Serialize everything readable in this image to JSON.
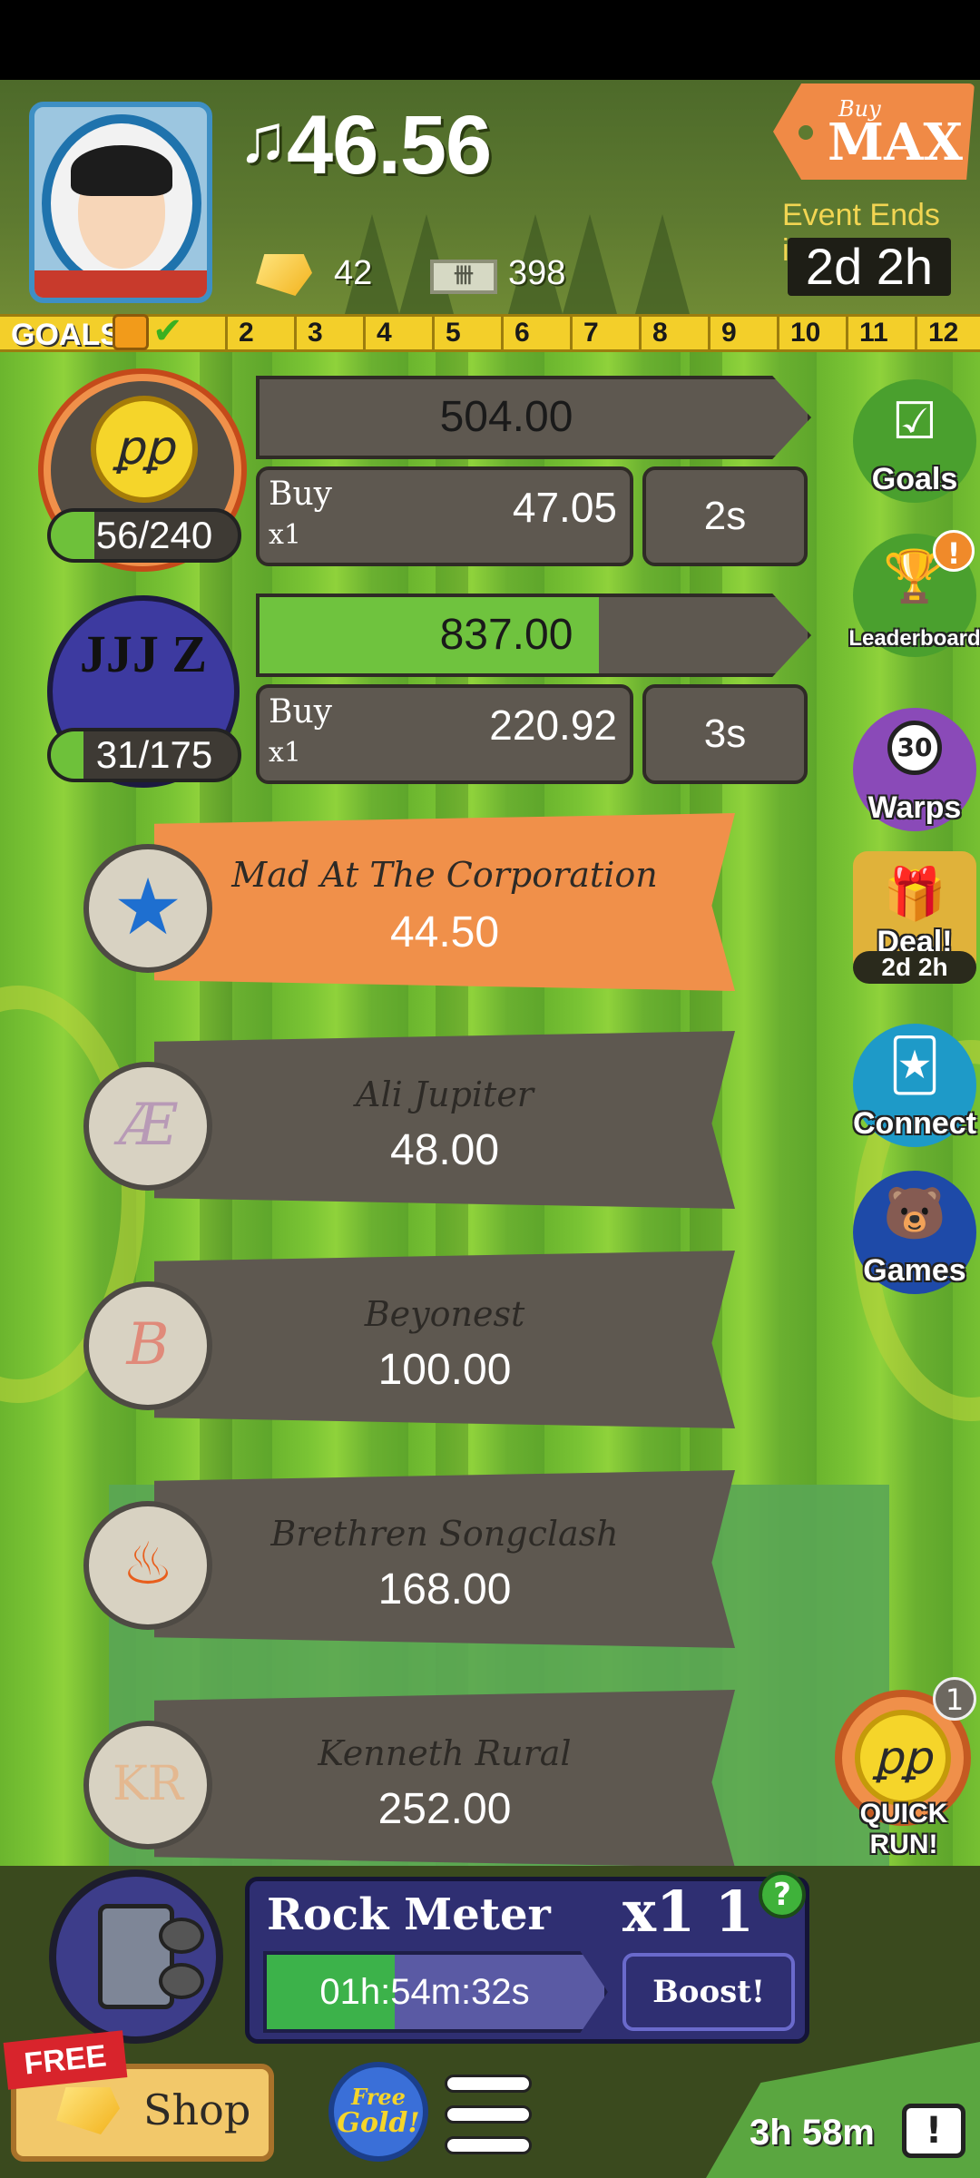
{
  "header": {
    "currency_symbol": "♫",
    "money": "46.56",
    "gold_count": "42",
    "cash_count": "398",
    "cash_icon_text": "卌",
    "buy_max_top": "Buy",
    "buy_max_bottom": "MAX",
    "event_label": "Event Ends in:",
    "event_timer": "2d 2h"
  },
  "goals": {
    "label": "GOALS",
    "ticks": [
      "2",
      "3",
      "4",
      "5",
      "6",
      "7",
      "8",
      "9",
      "10",
      "11",
      "12"
    ]
  },
  "artists": [
    {
      "logo": "ꝑꝑ",
      "progress_text": "56/240",
      "progress_fraction": 0.233,
      "revenue": "504.00",
      "revenue_fill": 0.0,
      "buy_label": "Buy",
      "buy_mult": "x1",
      "buy_price": "47.05",
      "cycle_time": "2s"
    },
    {
      "logo": "JJJ Z",
      "progress_text": "31/175",
      "progress_fraction": 0.177,
      "revenue": "837.00",
      "revenue_fill": 0.62,
      "buy_label": "Buy",
      "buy_mult": "x1",
      "buy_price": "220.92",
      "cycle_time": "3s"
    }
  ],
  "venues": [
    {
      "name": "Mad At The Corporation",
      "value": "44.50",
      "token": "★",
      "active": true
    },
    {
      "name": "Ali Jupiter",
      "value": "48.00",
      "token": "Æ",
      "active": false
    },
    {
      "name": "Beyonest",
      "value": "100.00",
      "token": "B",
      "active": false
    },
    {
      "name": "Brethren Songclash",
      "value": "168.00",
      "token": "♨",
      "active": false
    },
    {
      "name": "Kenneth Rural",
      "value": "252.00",
      "token": "KR",
      "active": false
    }
  ],
  "sidebar": {
    "goals": "Goals",
    "leaderboard": "Leaderboard",
    "warps": "Warps",
    "warps_count": "30",
    "deal": "Deal!",
    "deal_timer": "2d 2h",
    "connect": "Connect",
    "games": "Games",
    "quick_run": "QUICK RUN!",
    "quick_run_badge": "1",
    "quick_run_logo": "ꝑꝑ",
    "alert": "!"
  },
  "rock_meter": {
    "title": "Rock Meter",
    "multiplier": "x1 1",
    "help": "?",
    "timer": "01h:54m:32s",
    "timer_fill": 0.38,
    "boost": "Boost!"
  },
  "footer": {
    "free_ribbon": "FREE",
    "shop": "Shop",
    "free_gold_1": "Free",
    "free_gold_2": "Gold!",
    "tv_timer": "3h 58m",
    "tv_icon": "!"
  },
  "colors": {
    "accent_orange": "#f0904a",
    "panel_gray": "#5e5850",
    "progress_green": "#6ec13a",
    "rock_purple": "#2f2f72"
  }
}
